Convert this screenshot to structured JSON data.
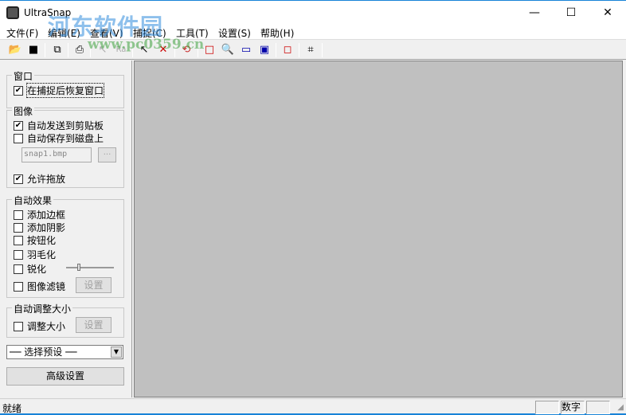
{
  "window": {
    "title": "UltraSnap",
    "minimize": "—",
    "maximize": "☐",
    "close": "✕"
  },
  "menu": [
    "文件(F)",
    "编辑(E)",
    "查看(V)",
    "捕捉(C)",
    "工具(T)",
    "设置(S)",
    "帮助(H)"
  ],
  "toolbar": [
    "open-icon",
    "save-icon",
    "copy-icon",
    "print-icon",
    "pointer-icon",
    "text-icon",
    "capture-pointer-icon",
    "no-pointer-icon",
    "refresh-icon",
    "rectangle-icon",
    "zoom-region-icon",
    "window-icon",
    "object-icon",
    "resize-icon",
    "crop-icon"
  ],
  "watermark": {
    "text": "河东软件园",
    "url": "www.pc0359.cn"
  },
  "panel": {
    "window_group": {
      "label": "窗口",
      "restore": {
        "label": "在捕捉后恢复窗口",
        "checked": true
      }
    },
    "image_group": {
      "label": "图像",
      "clipboard": {
        "label": "自动发送到剪贴板",
        "checked": true
      },
      "save_disk": {
        "label": "自动保存到磁盘上",
        "checked": false
      },
      "filename": "snap1.bmp",
      "browse": "...",
      "drag": {
        "label": "允许拖放",
        "checked": true
      }
    },
    "effects_group": {
      "label": "自动效果",
      "border": {
        "label": "添加边框",
        "checked": false
      },
      "shadow": {
        "label": "添加阴影",
        "checked": false
      },
      "button": {
        "label": "按钮化",
        "checked": false
      },
      "feather": {
        "label": "羽毛化",
        "checked": false
      },
      "sharpen": {
        "label": "锐化",
        "checked": false
      },
      "filter": {
        "label": "图像滤镜",
        "checked": false
      },
      "settings": "设置"
    },
    "resize_group": {
      "label": "自动调整大小",
      "resize": {
        "label": "调整大小",
        "checked": false
      },
      "settings": "设置"
    },
    "preset": "── 选择预设 ──",
    "advanced": "高级设置"
  },
  "status": {
    "text": "就绪",
    "num": "数字"
  }
}
